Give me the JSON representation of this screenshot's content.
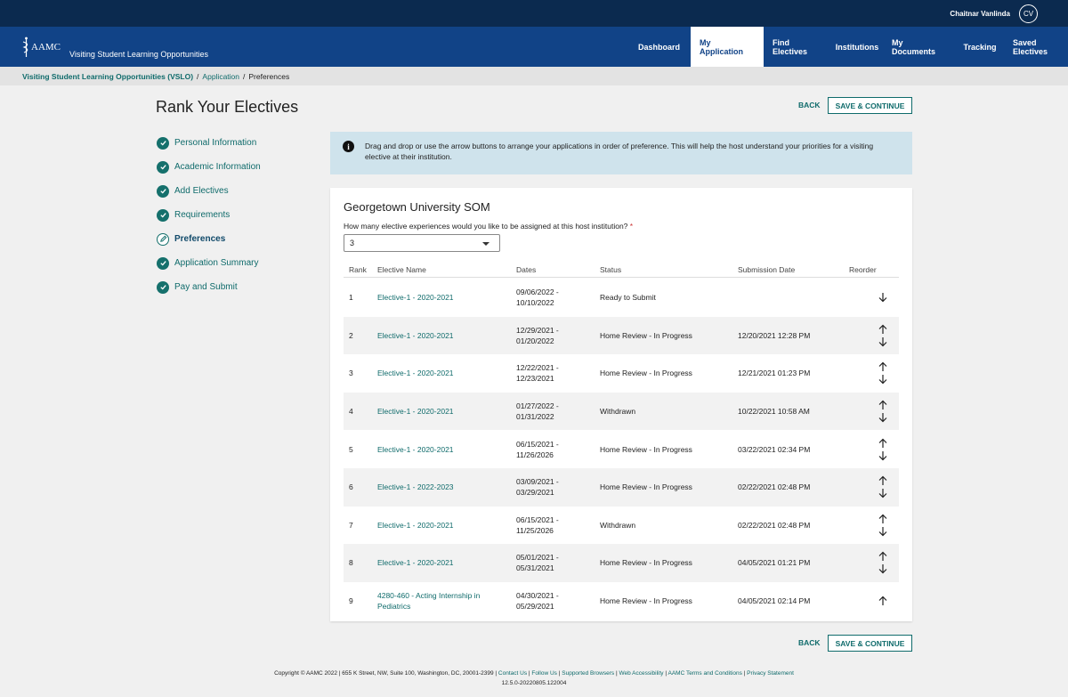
{
  "topbar": {
    "user_name": "Chaitnar Vanlinda",
    "user_initials": "CV"
  },
  "brand": {
    "logo_text": "AAMC",
    "title": "Visiting Student Learning Opportunities"
  },
  "nav": {
    "items": [
      "Dashboard",
      "My Application",
      "Find Electives",
      "Institutions",
      "My Documents",
      "Tracking",
      "Saved Electives"
    ],
    "active": "My Application"
  },
  "breadcrumb": {
    "root": "Visiting Student Learning Opportunities (VSLO)",
    "middle": "Application",
    "current": "Preferences",
    "sep": "/"
  },
  "page": {
    "title": "Rank Your Electives",
    "back_label": "BACK",
    "save_label": "SAVE & CONTINUE"
  },
  "steps": [
    {
      "label": "Personal Information",
      "state": "complete"
    },
    {
      "label": "Academic Information",
      "state": "complete"
    },
    {
      "label": "Add Electives",
      "state": "complete"
    },
    {
      "label": "Requirements",
      "state": "complete"
    },
    {
      "label": "Preferences",
      "state": "current"
    },
    {
      "label": "Application Summary",
      "state": "complete"
    },
    {
      "label": "Pay and Submit",
      "state": "complete"
    }
  ],
  "info": {
    "icon": "info-icon",
    "text": "Drag and drop or use the arrow buttons to arrange your applications in order of preference. This will help the host understand your priorities for a visiting elective at their institution."
  },
  "card": {
    "institution": "Georgetown University SOM",
    "question": "How many elective experiences would you like to be assigned at this host institution?",
    "required_mark": "*",
    "count_value": "3",
    "columns": {
      "rank": "Rank",
      "name": "Elective Name",
      "dates": "Dates",
      "status": "Status",
      "submission": "Submission Date",
      "reorder": "Reorder"
    },
    "rows": [
      {
        "rank": "1",
        "name": "Elective-1 - 2020-2021",
        "dates": "09/06/2022 - 10/10/2022",
        "status": "Ready to Submit",
        "submission": "",
        "up": false,
        "down": true
      },
      {
        "rank": "2",
        "name": "Elective-1 - 2020-2021",
        "dates": "12/29/2021 - 01/20/2022",
        "status": "Home Review - In Progress",
        "submission": "12/20/2021 12:28 PM",
        "up": true,
        "down": true
      },
      {
        "rank": "3",
        "name": "Elective-1 - 2020-2021",
        "dates": "12/22/2021 - 12/23/2021",
        "status": "Home Review - In Progress",
        "submission": "12/21/2021 01:23 PM",
        "up": true,
        "down": true
      },
      {
        "rank": "4",
        "name": "Elective-1 - 2020-2021",
        "dates": "01/27/2022 - 01/31/2022",
        "status": "Withdrawn",
        "submission": "10/22/2021 10:58 AM",
        "up": true,
        "down": true
      },
      {
        "rank": "5",
        "name": "Elective-1 - 2020-2021",
        "dates": "06/15/2021 - 11/26/2026",
        "status": "Home Review - In Progress",
        "submission": "03/22/2021 02:34 PM",
        "up": true,
        "down": true
      },
      {
        "rank": "6",
        "name": "Elective-1 - 2022-2023",
        "dates": "03/09/2021 - 03/29/2021",
        "status": "Home Review - In Progress",
        "submission": "02/22/2021 02:48 PM",
        "up": true,
        "down": true
      },
      {
        "rank": "7",
        "name": "Elective-1 - 2020-2021",
        "dates": "06/15/2021 - 11/25/2026",
        "status": "Withdrawn",
        "submission": "02/22/2021 02:48 PM",
        "up": true,
        "down": true
      },
      {
        "rank": "8",
        "name": "Elective-1 - 2020-2021",
        "dates": "05/01/2021 - 05/31/2021",
        "status": "Home Review - In Progress",
        "submission": "04/05/2021 01:21 PM",
        "up": true,
        "down": true
      },
      {
        "rank": "9",
        "name": "4280-460 - Acting Internship in Pediatrics",
        "dates": "04/30/2021 - 05/29/2021",
        "status": "Home Review - In Progress",
        "submission": "04/05/2021 02:14 PM",
        "up": true,
        "down": false
      }
    ]
  },
  "footer": {
    "copyright": "Copyright © AAMC 2022 | 655 K Street, NW, Suite 100, Washington, DC, 20001-2399 |",
    "links": [
      "Contact Us",
      "Follow Us",
      "Supported Browsers",
      "Web Accessibility",
      "AAMC Terms and Conditions",
      "Privacy Statement"
    ],
    "version": "12.5.0-20220805.122004"
  },
  "colors": {
    "topbar": "#0b2a4f",
    "navbar": "#114387",
    "accent": "#0f6b6b",
    "info_bg": "#cfe3ec"
  }
}
